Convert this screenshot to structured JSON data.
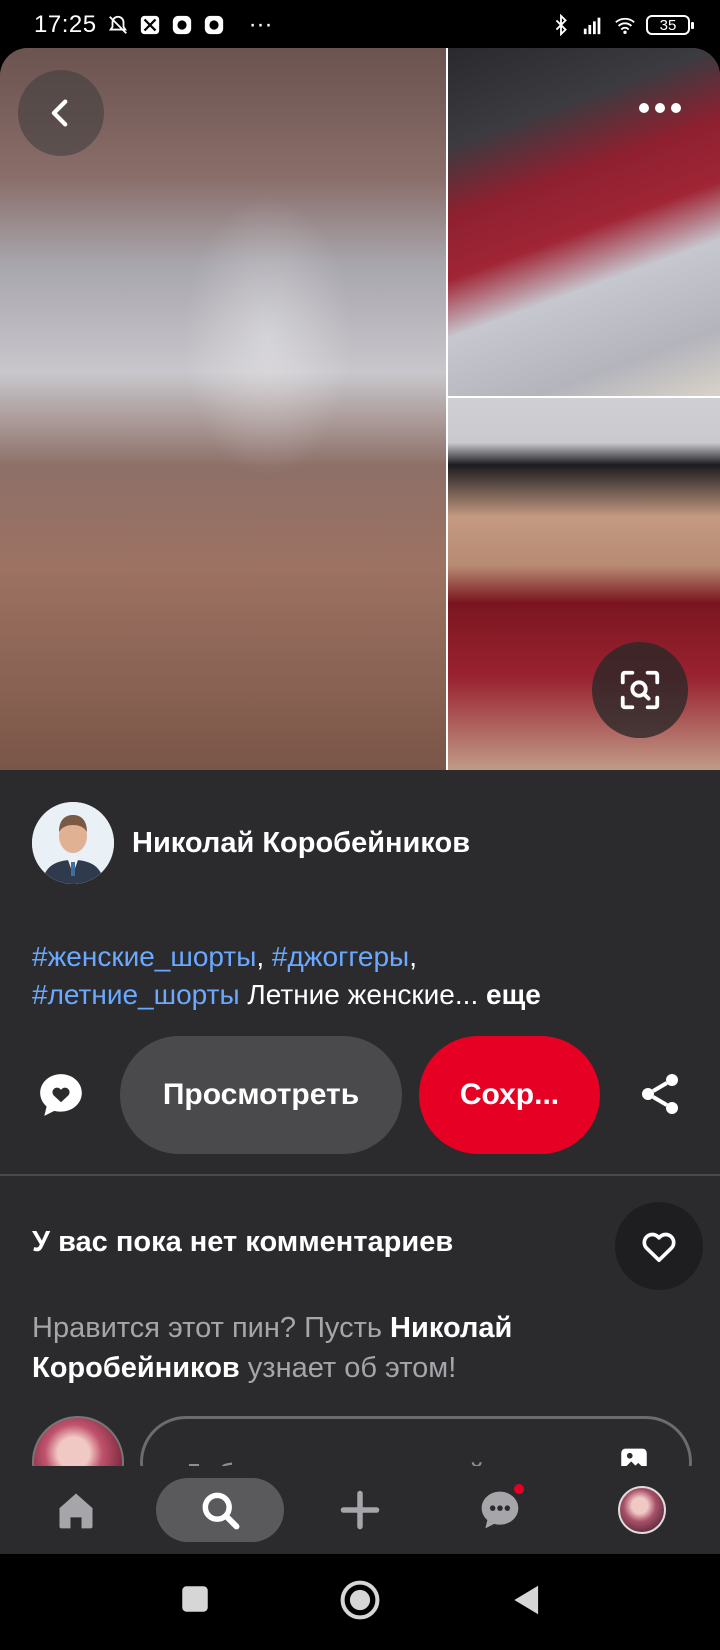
{
  "status_bar": {
    "time": "17:25",
    "more": "···",
    "battery": "35"
  },
  "pin": {
    "image_description_icons": [
      "back-icon",
      "more-icon",
      "visual-search-icon"
    ]
  },
  "author": {
    "name": "Николай Коробейников"
  },
  "description": {
    "tag1": "#женские_шорты",
    "sep1": ", ",
    "tag2": "#джоггеры",
    "sep2": ",",
    "tag3": "#летние_шорты",
    "text": " Летние женские...",
    "more": " еще"
  },
  "actions": {
    "view_label": "Просмотреть",
    "save_label": "Сохр..."
  },
  "comments": {
    "empty_title": "У вас пока нет комментариев",
    "invite_prefix": "Нравится этот пин? Пусть ",
    "invite_name": "Николай Коробейников",
    "invite_suffix": " узнает об этом!",
    "input_placeholder": "Добавьте комментарий"
  },
  "colors": {
    "save": "#e60023",
    "tag": "#6aa9ff",
    "panel": "#2b2a2d"
  }
}
